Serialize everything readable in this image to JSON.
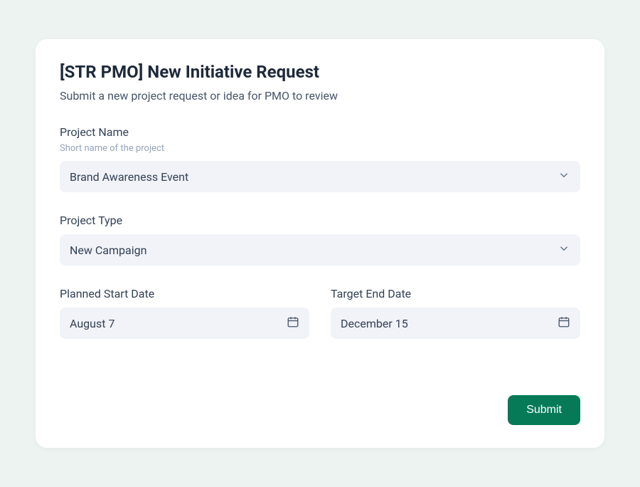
{
  "form": {
    "title": "[STR PMO] New Initiative Request",
    "subtitle": "Submit a new project request or idea for PMO to review",
    "fields": {
      "projectName": {
        "label": "Project Name",
        "hint": "Short name of the project",
        "value": "Brand Awareness Event"
      },
      "projectType": {
        "label": "Project Type",
        "value": "New Campaign"
      },
      "startDate": {
        "label": "Planned Start Date",
        "value": "August 7"
      },
      "endDate": {
        "label": "Target End Date",
        "value": "December 15"
      }
    },
    "submitLabel": "Submit"
  }
}
